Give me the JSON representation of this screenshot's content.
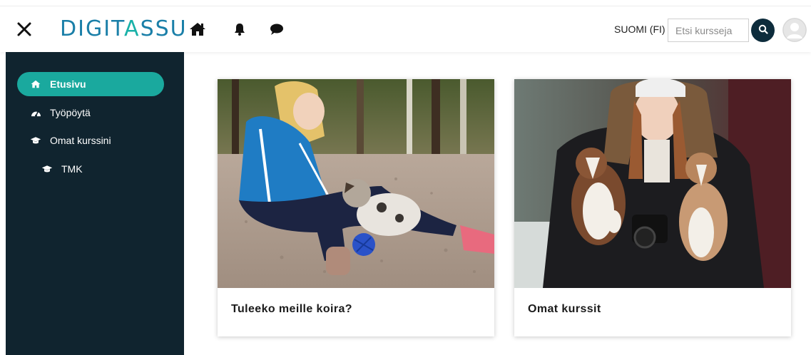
{
  "header": {
    "logo_main": "DIGIT",
    "logo_accent": "A",
    "logo_end": "SSU",
    "language": "SUOMI (FI)",
    "search_placeholder": "Etsi kursseja"
  },
  "icons": {
    "close": "close-icon",
    "home": "home-icon",
    "notifications": "bell-icon",
    "messages": "chat-bubble-icon",
    "search": "search-icon",
    "avatar": "user-avatar-icon"
  },
  "sidebar": {
    "items": [
      {
        "label": "Etusivu",
        "icon": "home-icon",
        "active": true
      },
      {
        "label": "Työpöytä",
        "icon": "dashboard-icon",
        "active": false
      },
      {
        "label": "Omat kurssini",
        "icon": "graduation-cap-icon",
        "active": false
      },
      {
        "label": "TMK",
        "icon": "graduation-cap-icon",
        "active": false
      }
    ]
  },
  "cards": [
    {
      "title": "Tuleeko meille koira?",
      "image": "woman-playing-with-puppy-photo"
    },
    {
      "title": "Omat kurssit",
      "image": "woman-holding-two-puppies-photo"
    }
  ],
  "colors": {
    "brand_blue": "#1a7fa8",
    "brand_teal": "#1aa99e",
    "sidebar_bg": "#10242f",
    "search_button": "#0d2c3c"
  }
}
